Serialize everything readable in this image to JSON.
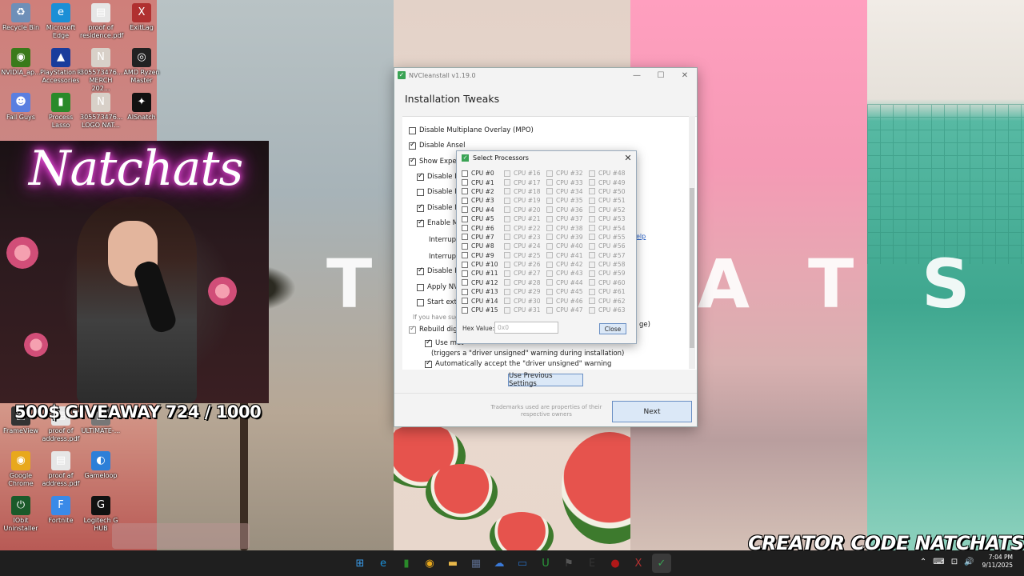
{
  "desktop": {
    "icons": [
      {
        "label": "Recycle Bin",
        "icon": "recycle-bin-icon",
        "color": "#6e8fb8",
        "glyph": "♻"
      },
      {
        "label": "Microsoft Edge",
        "icon": "edge-icon",
        "color": "#1b8fd6",
        "glyph": "e"
      },
      {
        "label": "proof of residence.pdf",
        "icon": "pdf-icon",
        "color": "#e6e6e6",
        "glyph": "▤"
      },
      {
        "label": "ExitLag",
        "icon": "exitlag-icon",
        "color": "#b03030",
        "glyph": "X"
      },
      {
        "label": "NVIDIA_ap...",
        "icon": "nvidia-icon",
        "color": "#3a7a1a",
        "glyph": "◉"
      },
      {
        "label": "PlayStation® Accessories",
        "icon": "playstation-icon",
        "color": "#1a3c9c",
        "glyph": "▲"
      },
      {
        "label": "305573476... MERCH 202...",
        "icon": "image-file-icon",
        "color": "#d8d0c8",
        "glyph": "N"
      },
      {
        "label": "AMD Ryzen Master",
        "icon": "amd-ryzen-icon",
        "color": "#222222",
        "glyph": "◎"
      },
      {
        "label": "Fall Guys",
        "icon": "fall-guys-icon",
        "color": "#5a7fe0",
        "glyph": "☻"
      },
      {
        "label": "Process Lasso",
        "icon": "process-lasso-icon",
        "color": "#2a8a2a",
        "glyph": "▮"
      },
      {
        "label": "305573476... LOGO NAT...",
        "icon": "image-file-icon",
        "color": "#d8d0c8",
        "glyph": "N"
      },
      {
        "label": "AISnatch",
        "icon": "aisnatch-icon",
        "color": "#111111",
        "glyph": "✦"
      },
      {
        "label": "FrameView",
        "icon": "frameview-icon",
        "color": "#333333",
        "glyph": "▣"
      },
      {
        "label": "proof of address.pdf",
        "icon": "pdf-icon",
        "color": "#e6e6e6",
        "glyph": "▤"
      },
      {
        "label": "ULTIMATE-...",
        "icon": "file-icon",
        "color": "#777777",
        "glyph": "▤"
      },
      {
        "label": "Google Chrome",
        "icon": "chrome-icon",
        "color": "#e8a81c",
        "glyph": "◉"
      },
      {
        "label": "proof af address.pdf",
        "icon": "pdf-icon",
        "color": "#e6e6e6",
        "glyph": "▤"
      },
      {
        "label": "Gameloop",
        "icon": "gameloop-icon",
        "color": "#2d7fd8",
        "glyph": "◐"
      },
      {
        "label": "IObit Uninstaller",
        "icon": "iobit-icon",
        "color": "#1a5a2a",
        "glyph": "⏻"
      },
      {
        "label": "Fortnite",
        "icon": "fortnite-icon",
        "color": "#3a8ae8",
        "glyph": "F"
      },
      {
        "label": "Logitech G HUB",
        "icon": "logitech-icon",
        "color": "#111111",
        "glyph": "G"
      }
    ]
  },
  "wallpaper": {
    "letters": [
      "T",
      "A",
      "T",
      "S"
    ]
  },
  "overlay": {
    "neon_name": "Natchats",
    "giveaway": "500$ GIVEAWAY  724 / 1000",
    "creator_code": "CREATOR CODE NATCHATS"
  },
  "window": {
    "title": "NVCleanstall v1.19.0",
    "heading": "Installation Tweaks",
    "options": [
      {
        "label": "Disable Multiplane Overlay (MPO)",
        "checked": false
      },
      {
        "label": "Disable Ansel",
        "checked": true
      },
      {
        "label": "Show Expert",
        "checked": true
      },
      {
        "label": "Disable Dri",
        "checked": true
      },
      {
        "label": "Disable NV",
        "checked": false
      },
      {
        "label": "Disable NV",
        "checked": true
      },
      {
        "label": "Enable Mes",
        "checked": true
      },
      {
        "label": "Interrupt",
        "checked": null
      },
      {
        "label": "Interrupt",
        "checked": null
      },
      {
        "label": "Disable HD",
        "checked": true
      },
      {
        "label": "Apply NVEI",
        "checked": false
      },
      {
        "label": "Start extern",
        "checked": false
      },
      {
        "label": "If you have sug",
        "checked": null
      },
      {
        "label": "Rebuild digit",
        "checked": true
      },
      {
        "label": "Use met",
        "checked": true
      },
      {
        "label": "(triggers a \"driver unsigned\" warning during installation)",
        "checked": null
      },
      {
        "label": "Automatically accept the \"driver unsigned\" warning",
        "checked": true
      }
    ],
    "help_link": "elp",
    "right_suffix": "ge)",
    "use_previous_button": "Use Previous Settings",
    "trademark": "Trademarks used are properties of their respective owners",
    "next_button": "Next"
  },
  "dialog": {
    "title": "Select Processors",
    "close_x": "✕",
    "cpus": [
      "CPU #0",
      "CPU #1",
      "CPU #2",
      "CPU #3",
      "CPU #4",
      "CPU #5",
      "CPU #6",
      "CPU #7",
      "CPU #8",
      "CPU #9",
      "CPU #10",
      "CPU #11",
      "CPU #12",
      "CPU #13",
      "CPU #14",
      "CPU #15",
      "CPU #16",
      "CPU #17",
      "CPU #18",
      "CPU #19",
      "CPU #20",
      "CPU #21",
      "CPU #22",
      "CPU #23",
      "CPU #24",
      "CPU #25",
      "CPU #26",
      "CPU #27",
      "CPU #28",
      "CPU #29",
      "CPU #30",
      "CPU #31",
      "CPU #32",
      "CPU #33",
      "CPU #34",
      "CPU #35",
      "CPU #36",
      "CPU #37",
      "CPU #38",
      "CPU #39",
      "CPU #40",
      "CPU #41",
      "CPU #42",
      "CPU #43",
      "CPU #44",
      "CPU #45",
      "CPU #46",
      "CPU #47",
      "CPU #48",
      "CPU #49",
      "CPU #50",
      "CPU #51",
      "CPU #52",
      "CPU #53",
      "CPU #54",
      "CPU #55",
      "CPU #56",
      "CPU #57",
      "CPU #58",
      "CPU #59",
      "CPU #60",
      "CPU #61",
      "CPU #62",
      "CPU #63"
    ],
    "enabled_count": 16,
    "hex_label": "Hex Value:",
    "hex_placeholder": "0x0",
    "close_button": "Close"
  },
  "taskbar": {
    "apps": [
      {
        "icon": "windows-start-icon",
        "glyph": "⊞",
        "color": "#3a9be8"
      },
      {
        "icon": "edge-icon",
        "glyph": "e",
        "color": "#1b8fd6"
      },
      {
        "icon": "process-lasso-icon",
        "glyph": "▮",
        "color": "#2a8a2a"
      },
      {
        "icon": "chrome-icon",
        "glyph": "◉",
        "color": "#e8a81c"
      },
      {
        "icon": "file-explorer-icon",
        "glyph": "▬",
        "color": "#e8b84a"
      },
      {
        "icon": "store-icon",
        "glyph": "▦",
        "color": "#5a6a8a"
      },
      {
        "icon": "weather-icon",
        "glyph": "☁",
        "color": "#3a7ad8"
      },
      {
        "icon": "remote-icon",
        "glyph": "▭",
        "color": "#2a6ab8"
      },
      {
        "icon": "upwork-icon",
        "glyph": "U",
        "color": "#2a9a3a"
      },
      {
        "icon": "fl-icon",
        "glyph": "⚑",
        "color": "#555555"
      },
      {
        "icon": "epic-games-icon",
        "glyph": "E",
        "color": "#333333"
      },
      {
        "icon": "record-icon",
        "glyph": "●",
        "color": "#b01818"
      },
      {
        "icon": "exitlag-icon",
        "glyph": "X",
        "color": "#b03030"
      },
      {
        "icon": "nvcleanstall-icon",
        "glyph": "✓",
        "color": "#3aa354"
      }
    ],
    "tray_icons": [
      "⌃",
      "⌨",
      "⊡",
      "🔊"
    ],
    "time": "7:04 PM",
    "date": "9/11/2025"
  }
}
